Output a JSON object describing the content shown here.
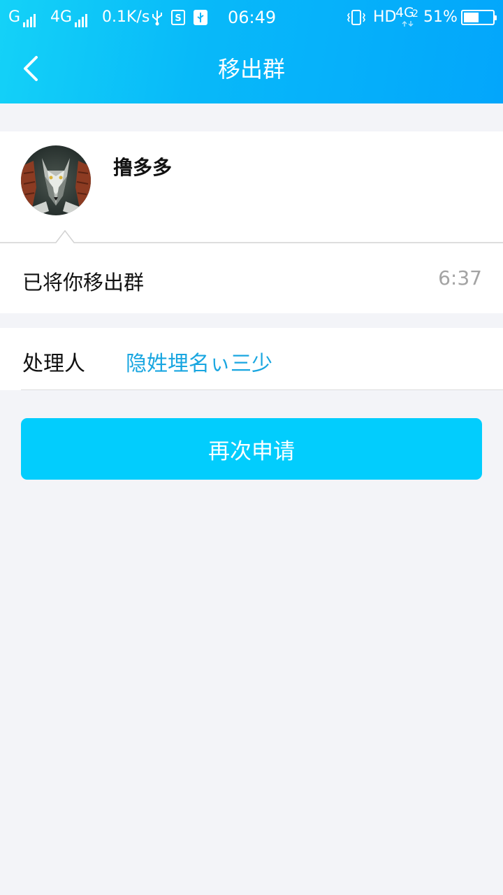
{
  "status_bar": {
    "carrier1": "G",
    "carrier2": "4G",
    "speed": "0.1K/s",
    "time": "06:49",
    "hd": "HD",
    "network": "4G",
    "sim": "2",
    "battery": "51%"
  },
  "nav": {
    "title": "移出群"
  },
  "notice": {
    "sender": "撸多多",
    "message": "已将你移出群",
    "time": "6:37"
  },
  "handler": {
    "label": "处理人",
    "name": "隐姓埋名ぃ三少"
  },
  "actions": {
    "reapply": "再次申请"
  },
  "colors": {
    "header_start": "#14d2f8",
    "header_end": "#03a6fb",
    "button": "#02cdfd",
    "link": "#19a6e0",
    "background": "#f3f4f8"
  }
}
